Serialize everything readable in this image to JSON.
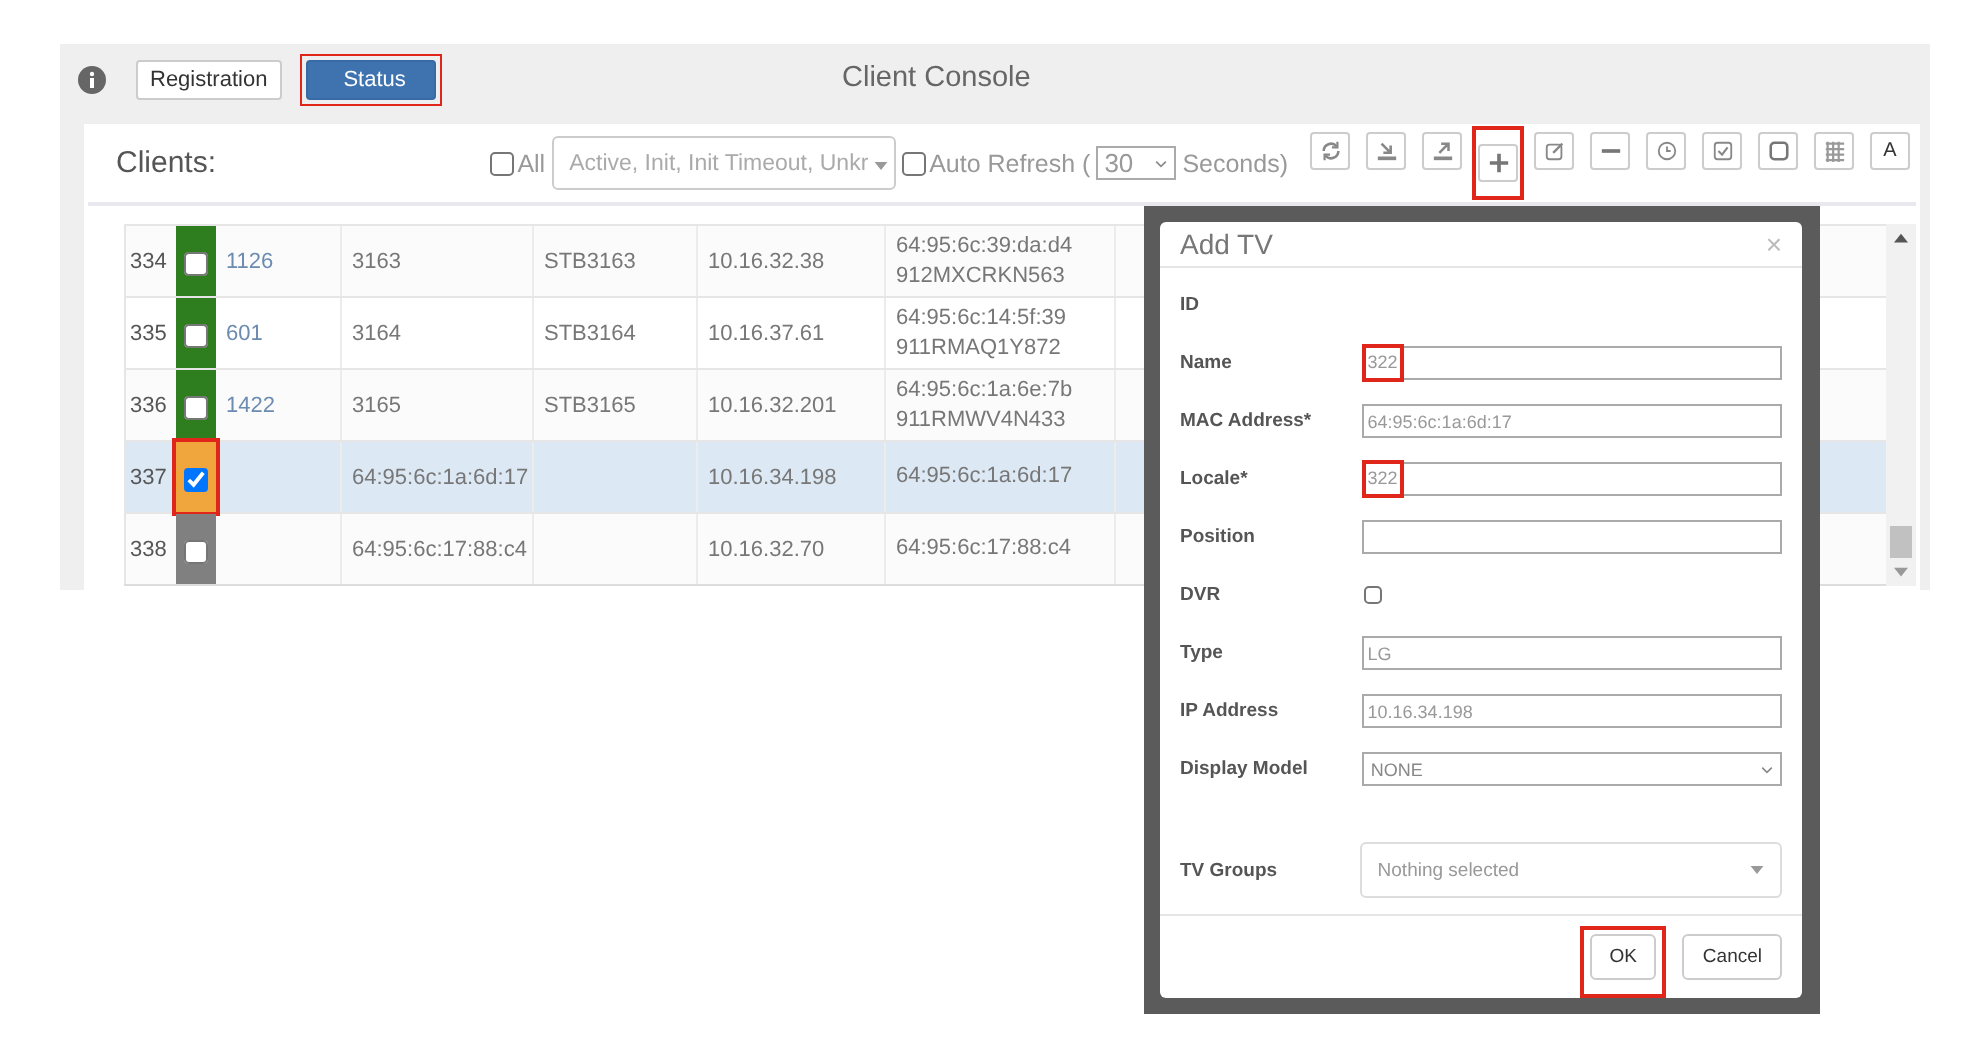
{
  "header": {
    "tabs": [
      {
        "label": "Registration",
        "selected": false,
        "highlighted": false
      },
      {
        "label": "Status",
        "selected": true,
        "highlighted": true
      }
    ],
    "title": "Client Console"
  },
  "clients": {
    "label": "Clients:",
    "all": {
      "label": "All",
      "checked": false
    },
    "status_filter": {
      "value": "Active, Init, Init Timeout, Unkr"
    },
    "auto_refresh": {
      "label": "Auto Refresh (",
      "checked": false,
      "interval": "30",
      "suffix": "Seconds)"
    },
    "toolbar": [
      {
        "kind": "refresh",
        "highlighted": false
      },
      {
        "kind": "import",
        "highlighted": false
      },
      {
        "kind": "export",
        "highlighted": false
      },
      {
        "kind": "add",
        "highlighted": true
      },
      {
        "kind": "edit",
        "highlighted": false
      },
      {
        "kind": "remove",
        "highlighted": false
      },
      {
        "kind": "clock",
        "highlighted": false
      },
      {
        "kind": "check",
        "highlighted": false
      },
      {
        "kind": "square",
        "highlighted": false
      },
      {
        "kind": "grid",
        "highlighted": false
      },
      {
        "kind": "text",
        "label": "A",
        "highlighted": false
      }
    ]
  },
  "table": {
    "rows": [
      {
        "number": "334",
        "color": "#2e7d1f",
        "checked": false,
        "selected": false,
        "highlighted": false,
        "column_3": "1126",
        "column_4": "3163",
        "column_5": "STB3163",
        "column_6": "10.16.32.38",
        "column_7": [
          "64:95:6c:39:da:d4",
          "912MXCRKN563"
        ]
      },
      {
        "number": "335",
        "color": "#2e7d1f",
        "checked": false,
        "selected": false,
        "highlighted": false,
        "column_3": "601",
        "column_4": "3164",
        "column_5": "STB3164",
        "column_6": "10.16.37.61",
        "column_7": [
          "64:95:6c:14:5f:39",
          "911RMAQ1Y872"
        ]
      },
      {
        "number": "336",
        "color": "#2e7d1f",
        "checked": false,
        "selected": false,
        "highlighted": false,
        "column_3": "1422",
        "column_4": "3165",
        "column_5": "STB3165",
        "column_6": "10.16.32.201",
        "column_7": [
          "64:95:6c:1a:6e:7b",
          "911RMWV4N433"
        ]
      },
      {
        "number": "337",
        "color": "#f0a63c",
        "checked": true,
        "selected": true,
        "highlighted": true,
        "column_4": "64:95:6c:1a:6d:17",
        "column_6": "10.16.34.198",
        "column_7": [
          "64:95:6c:1a:6d:17"
        ]
      },
      {
        "number": "338",
        "color": "#808080",
        "checked": false,
        "selected": false,
        "highlighted": false,
        "column_4": "64:95:6c:17:88:c4",
        "column_6": "10.16.32.70",
        "column_7": [
          "64:95:6c:17:88:c4"
        ]
      }
    ]
  },
  "dialog": {
    "title": "Add TV",
    "close": "×",
    "fields": [
      {
        "kind": "static",
        "label": "ID"
      },
      {
        "kind": "input",
        "label": "Name",
        "value": "322",
        "highlighted": true
      },
      {
        "kind": "input",
        "label": "MAC Address*",
        "value": "64:95:6c:1a:6d:17"
      },
      {
        "kind": "input",
        "label": "Locale*",
        "value": "322",
        "highlighted": true
      },
      {
        "kind": "input",
        "label": "Position"
      },
      {
        "kind": "checkbox",
        "label": "DVR",
        "checked": false
      },
      {
        "kind": "input",
        "label": "Type",
        "value": "LG"
      },
      {
        "kind": "input",
        "label": "IP Address",
        "value": "10.16.34.198"
      },
      {
        "kind": "select",
        "label": "Display Model",
        "value": "NONE"
      },
      {
        "kind": "multiselect",
        "label": "TV Groups",
        "placeholder": "Nothing selected"
      }
    ],
    "buttons": [
      {
        "label": "OK",
        "highlighted": true
      },
      {
        "label": "Cancel",
        "highlighted": false
      }
    ]
  }
}
